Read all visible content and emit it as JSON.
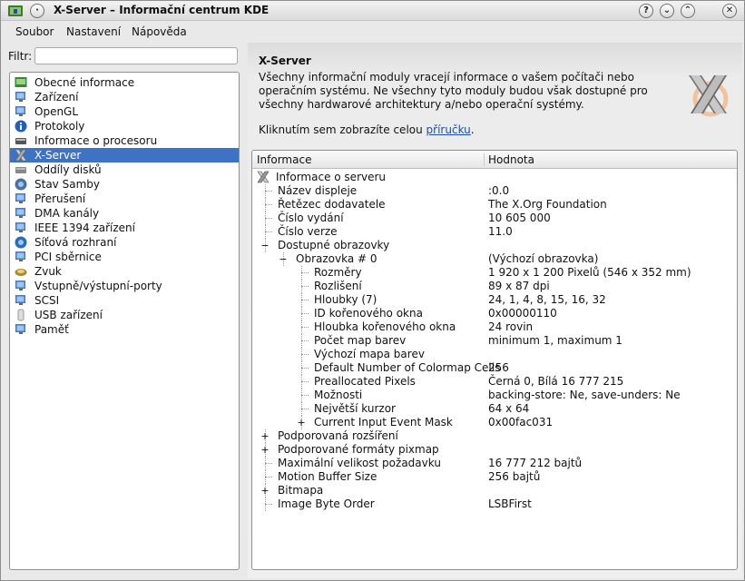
{
  "window": {
    "title": "X-Server – Informační centrum KDE",
    "buttons": {
      "help": "?",
      "minimize": "⌄",
      "maximize": "⌃",
      "close": "✕"
    }
  },
  "menubar": {
    "items": [
      "Soubor",
      "Nastavení",
      "Nápověda"
    ]
  },
  "filter": {
    "label": "Filtr:",
    "value": ""
  },
  "modules": [
    {
      "label": "Obecné informace",
      "icon": "system-info-icon"
    },
    {
      "label": "Zařízení",
      "icon": "devices-icon"
    },
    {
      "label": "OpenGL",
      "icon": "opengl-icon"
    },
    {
      "label": "Protokoly",
      "icon": "info-icon"
    },
    {
      "label": "Informace o procesoru",
      "icon": "cpu-icon"
    },
    {
      "label": "X-Server",
      "icon": "x-server-icon",
      "selected": true
    },
    {
      "label": "Oddíly disků",
      "icon": "disk-partitions-icon"
    },
    {
      "label": "Stav Samby",
      "icon": "samba-icon"
    },
    {
      "label": "Přerušení",
      "icon": "interrupts-icon"
    },
    {
      "label": "DMA kanály",
      "icon": "dma-icon"
    },
    {
      "label": "IEEE 1394 zařízení",
      "icon": "firewire-icon"
    },
    {
      "label": "Síťová rozhraní",
      "icon": "network-icon"
    },
    {
      "label": "PCI sběrnice",
      "icon": "pci-icon"
    },
    {
      "label": "Zvuk",
      "icon": "sound-icon"
    },
    {
      "label": "Vstupně/výstupní-porty",
      "icon": "io-ports-icon"
    },
    {
      "label": "SCSI",
      "icon": "scsi-icon"
    },
    {
      "label": "USB zařízení",
      "icon": "usb-icon"
    },
    {
      "label": "Paměť",
      "icon": "memory-icon"
    }
  ],
  "content": {
    "title": "X-Server",
    "description": "Všechny informační moduly vracejí informace o vašem počítači nebo operačním systému. Ne všechny tyto moduly budou však dostupné pro všechny hardwarové architektury a/nebo operační systémy.",
    "help_prefix": "Kliknutím sem zobrazíte celou ",
    "help_link": "příručku",
    "help_suffix": "."
  },
  "tree": {
    "columns": [
      "Informace",
      "Hodnota"
    ],
    "rows": [
      {
        "key": "Informace o serveru",
        "value": "",
        "depth": 0,
        "toggle": "",
        "icon": "x-icon"
      },
      {
        "key": "Název displeje",
        "value": ":0.0",
        "depth": 1,
        "toggle": ""
      },
      {
        "key": "Řetězec dodavatele",
        "value": "The X.Org Foundation",
        "depth": 1,
        "toggle": ""
      },
      {
        "key": "Číslo vydání",
        "value": "10 605 000",
        "depth": 1,
        "toggle": ""
      },
      {
        "key": "Číslo verze",
        "value": "11.0",
        "depth": 1,
        "toggle": ""
      },
      {
        "key": "Dostupné obrazovky",
        "value": "",
        "depth": 1,
        "toggle": "−"
      },
      {
        "key": "Obrazovka # 0",
        "value": "(Výchozí obrazovka)",
        "depth": 2,
        "toggle": "−"
      },
      {
        "key": "Rozměry",
        "value": "1 920 x 1 200 Pixelů (546 x 352 mm)",
        "depth": 3,
        "toggle": ""
      },
      {
        "key": "Rozlišení",
        "value": "89 x 87 dpi",
        "depth": 3,
        "toggle": ""
      },
      {
        "key": "Hloubky (7)",
        "value": "24, 1, 4, 8, 15, 16, 32",
        "depth": 3,
        "toggle": ""
      },
      {
        "key": "ID kořenového okna",
        "value": "0x00000110",
        "depth": 3,
        "toggle": ""
      },
      {
        "key": "Hloubka kořenového okna",
        "value": "24 rovin",
        "depth": 3,
        "toggle": ""
      },
      {
        "key": "Počet map barev",
        "value": "minimum 1, maximum 1",
        "depth": 3,
        "toggle": ""
      },
      {
        "key": "Výchozí mapa barev",
        "value": "",
        "depth": 3,
        "toggle": ""
      },
      {
        "key": "Default Number of Colormap Cells",
        "value": "256",
        "depth": 3,
        "toggle": ""
      },
      {
        "key": "Preallocated Pixels",
        "value": "Černá 0, Bílá 16 777 215",
        "depth": 3,
        "toggle": ""
      },
      {
        "key": "Možnosti",
        "value": "backing-store: Ne, save-unders: Ne",
        "depth": 3,
        "toggle": ""
      },
      {
        "key": "Největší kurzor",
        "value": "64 x 64",
        "depth": 3,
        "toggle": ""
      },
      {
        "key": "Current Input Event Mask",
        "value": "0x00fac031",
        "depth": 3,
        "toggle": "+"
      },
      {
        "key": "Podporovaná rozšíření",
        "value": "",
        "depth": 1,
        "toggle": "+"
      },
      {
        "key": "Podporované formáty pixmap",
        "value": "",
        "depth": 1,
        "toggle": "+"
      },
      {
        "key": "Maximální velikost požadavku",
        "value": "16 777 212 bajtů",
        "depth": 1,
        "toggle": ""
      },
      {
        "key": "Motion Buffer Size",
        "value": "256 bajtů",
        "depth": 1,
        "toggle": ""
      },
      {
        "key": "Bitmapa",
        "value": "",
        "depth": 1,
        "toggle": "+"
      },
      {
        "key": "Image Byte Order",
        "value": "LSBFirst",
        "depth": 1,
        "toggle": ""
      }
    ]
  }
}
